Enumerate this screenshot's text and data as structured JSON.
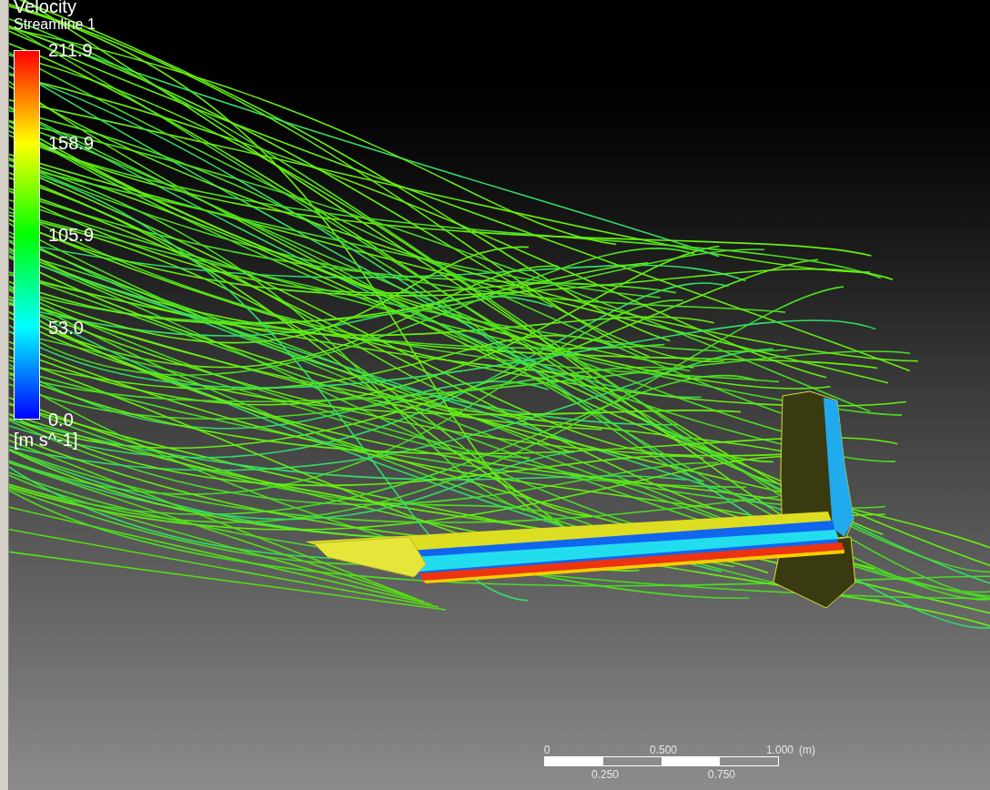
{
  "legend": {
    "title": "Velocity",
    "subtitle": "Streamline 1",
    "ticks": [
      "211.9",
      "158.9",
      "105.9",
      "53.0",
      "0.0"
    ],
    "unit": "[m s^-1]"
  },
  "scale_bar": {
    "top_labels": [
      "0",
      "0.500",
      "1.000"
    ],
    "unit": "(m)",
    "bottom_labels": [
      "0.250",
      "0.750"
    ]
  }
}
